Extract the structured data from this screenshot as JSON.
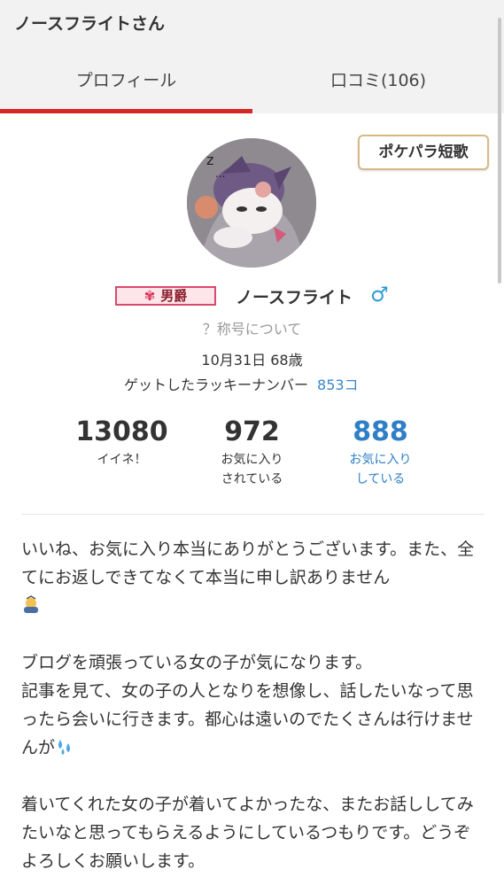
{
  "header": {
    "title": "ノースフライトさん",
    "tabs": [
      {
        "label": "プロフィール",
        "active": true
      },
      {
        "label": "口コミ(106)",
        "active": false
      }
    ],
    "accent_color": "#d42828"
  },
  "profile": {
    "tanka_badge": "ポケパラ短歌",
    "rank_badge": "男爵",
    "name": "ノースフライト",
    "gender_icon": "male-symbol-icon",
    "title_help": "？称号について",
    "birthday": "10月31日 68歳",
    "lucky_label": "ゲットしたラッキーナンバー",
    "lucky_value": "853コ"
  },
  "stats": [
    {
      "value": "13080",
      "label_line1": "イイネ！",
      "label_line2": ""
    },
    {
      "value": "972",
      "label_line1": "お気に入り",
      "label_line2": "されている"
    },
    {
      "value": "888",
      "label_line1": "お気に入り",
      "label_line2": "している"
    }
  ],
  "intro": {
    "p1": "いいね、お気に入り本当にありがとうございます。また、全てにお返しできてなくて本当に申し訳ありません",
    "p2_line1": "ブログを頑張っている女の子が気になります。",
    "p2_line2": "記事を見て、女の子の人となりを想像し、話したいなって思ったら会いに行きます。都心は遠いのでたくさんは行けませんが",
    "p3": "着いてくれた女の子が着いてよかったな、またお話ししてみたいなと思ってもらえるようにしているつもりです。どうぞよろしくお願いします。"
  }
}
